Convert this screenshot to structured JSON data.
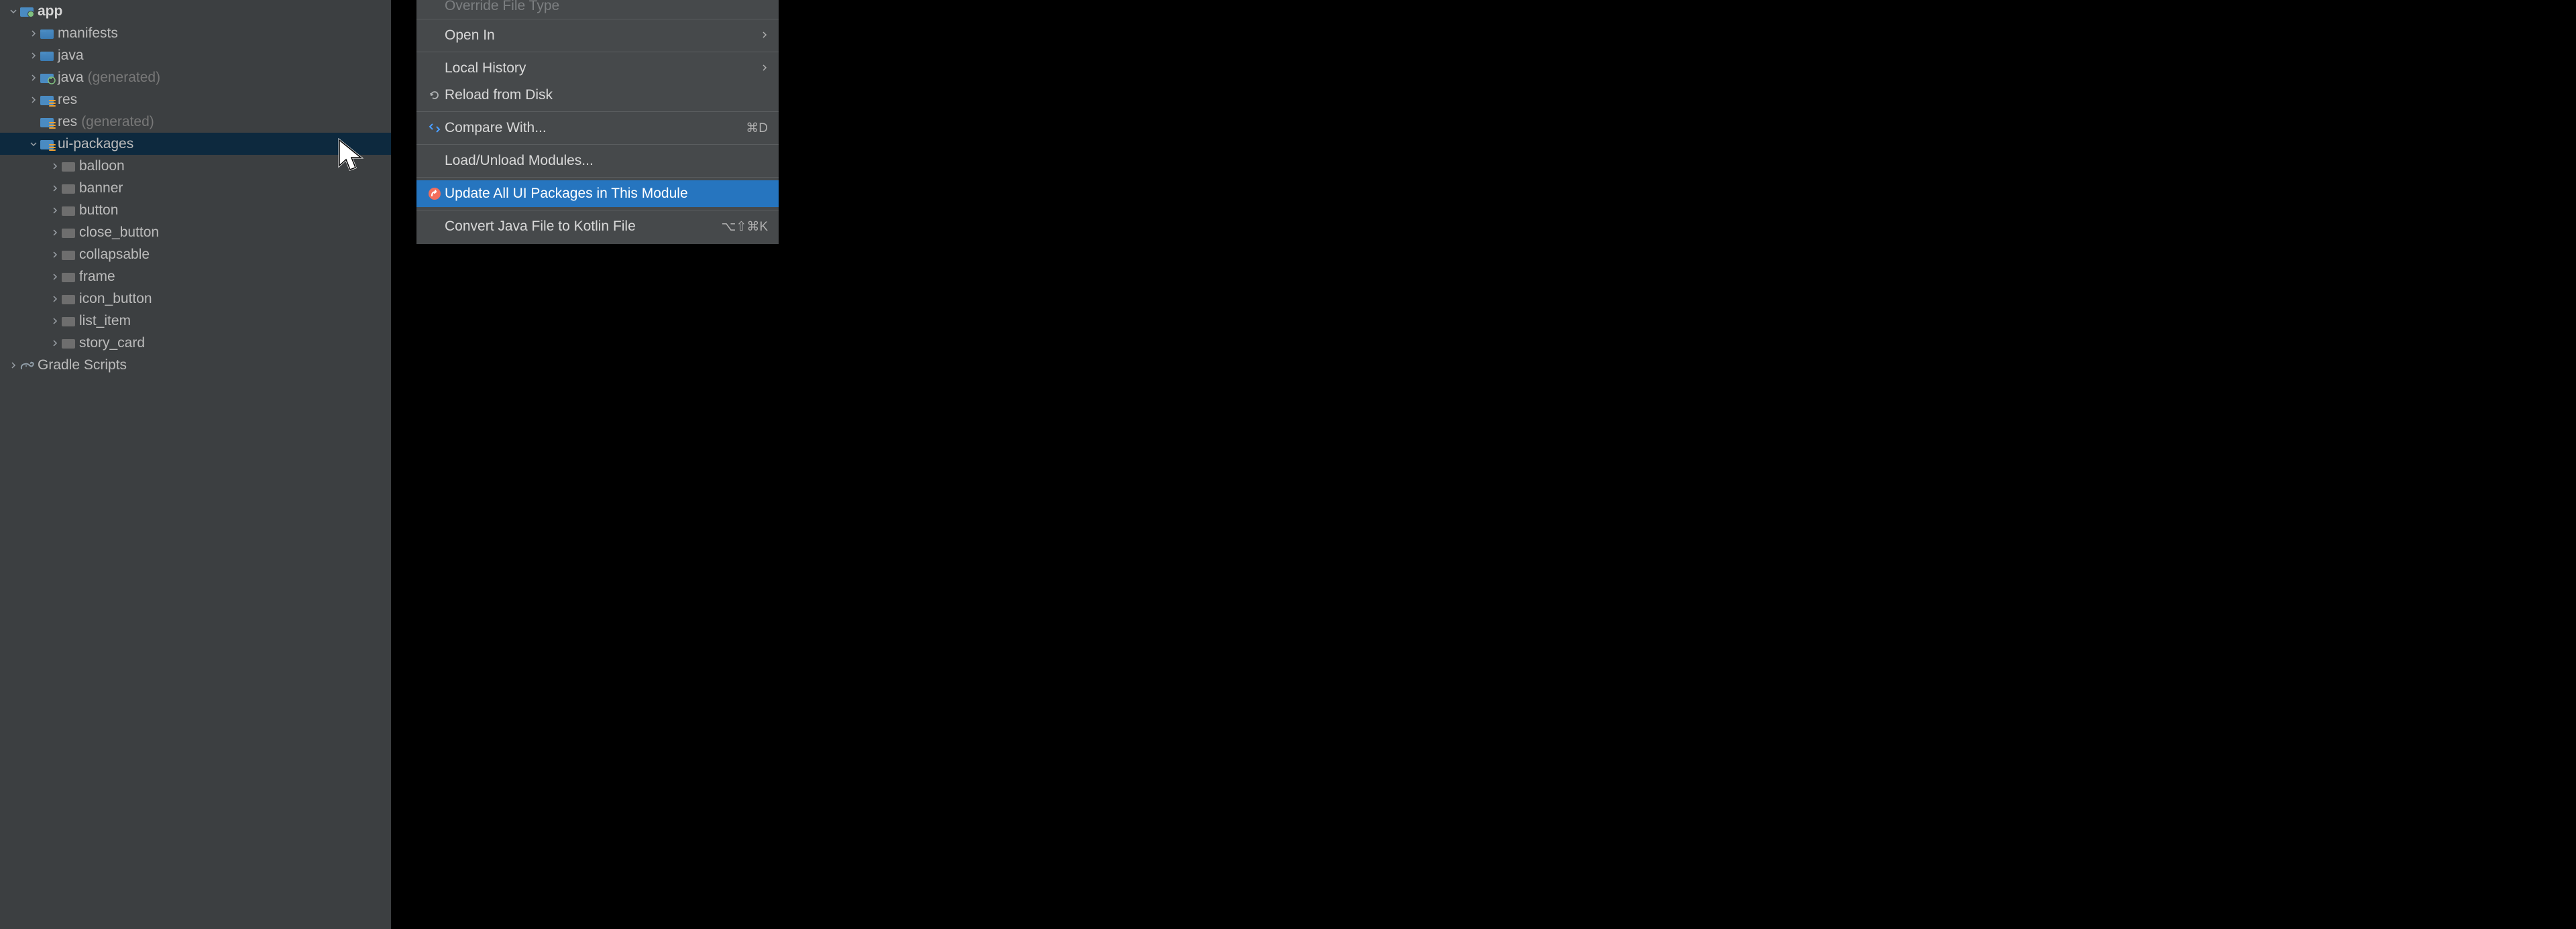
{
  "tree": {
    "app": "app",
    "manifests": "manifests",
    "java": "java",
    "java_gen": "java",
    "generated": "(generated)",
    "res": "res",
    "res_gen": "res",
    "ui_packages": "ui-packages",
    "balloon": "balloon",
    "banner": "banner",
    "button": "button",
    "close_button": "close_button",
    "collapsable": "collapsable",
    "frame": "frame",
    "icon_button": "icon_button",
    "list_item": "list_item",
    "story_card": "story_card",
    "gradle_scripts": "Gradle Scripts"
  },
  "menu": {
    "override_file_type": "Override File Type",
    "open_in": "Open In",
    "local_history": "Local History",
    "reload_from_disk": "Reload from Disk",
    "compare_with": "Compare With...",
    "compare_with_shortcut": "⌘D",
    "load_unload_modules": "Load/Unload Modules...",
    "update_ui_packages": "Update All UI Packages in This Module",
    "convert_java_kotlin": "Convert Java File to Kotlin File",
    "convert_shortcut": "⌥⇧⌘K"
  }
}
